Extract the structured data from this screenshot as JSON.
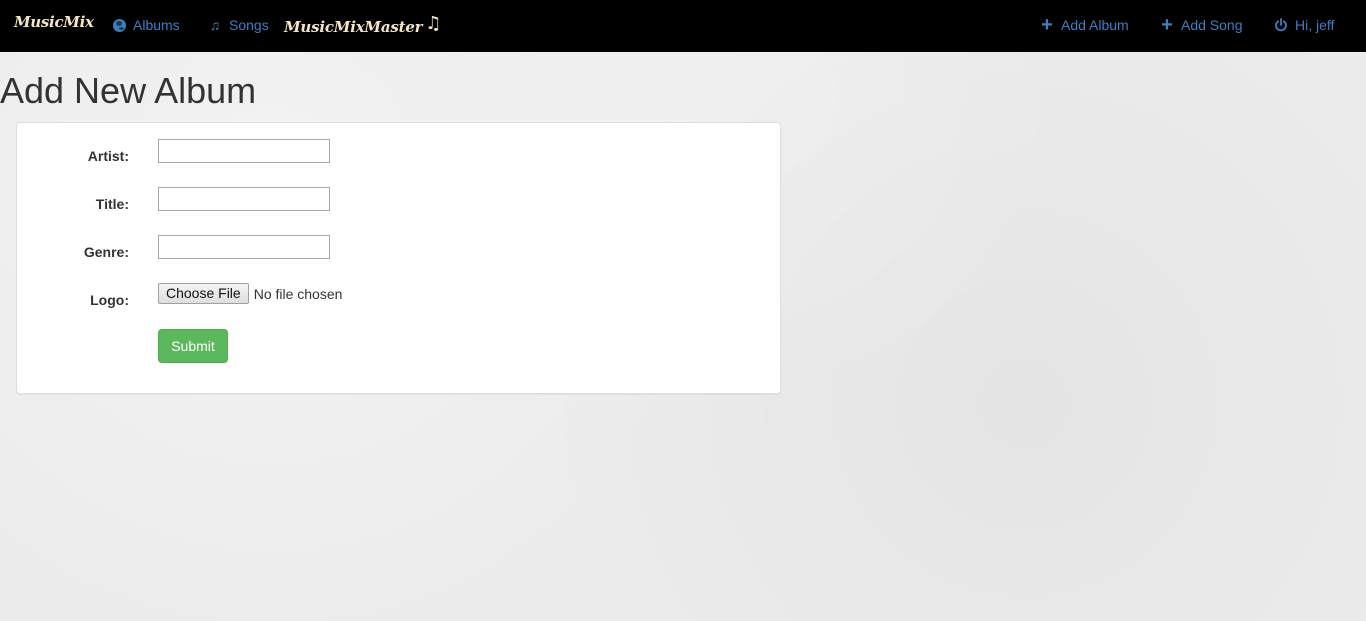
{
  "navbar": {
    "brand": "MusicMix",
    "brand_master": "MusicMixMaster",
    "albums_label": "Albums",
    "songs_label": "Songs",
    "add_album_label": "Add Album",
    "add_song_label": "Add Song",
    "user_label": "Hi, jeff"
  },
  "page": {
    "title": "Add New Album"
  },
  "form": {
    "artist_label": "Artist:",
    "artist_value": "",
    "title_label": "Title:",
    "title_value": "",
    "genre_label": "Genre:",
    "genre_value": "",
    "logo_label": "Logo:",
    "file_button_label": "Choose File",
    "file_status": "No file chosen",
    "submit_label": "Submit"
  },
  "colors": {
    "navbar_bg": "#000000",
    "link": "#3a7fc1",
    "brand": "#f6e7c1",
    "submit": "#5cb85c",
    "page_bg": "#ececec"
  },
  "icons": {
    "albums": "globe-icon",
    "songs": "music-note-icon",
    "brand_master": "music-note-icon",
    "add_album": "plus-icon",
    "add_song": "plus-icon",
    "user": "power-icon"
  }
}
